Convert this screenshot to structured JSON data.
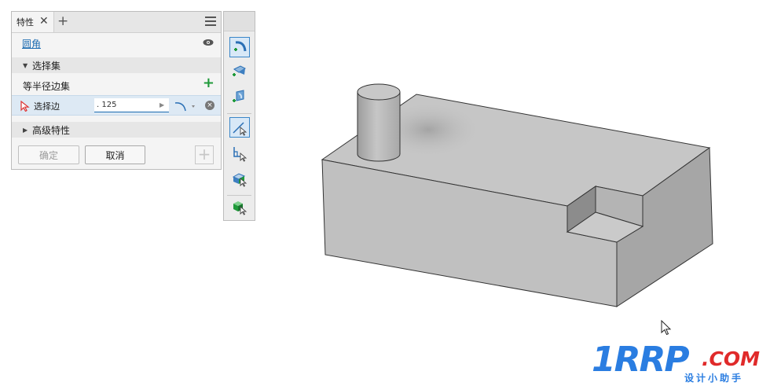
{
  "panel": {
    "tab_label": "特性",
    "tab_close": "✕",
    "tab_add": "+",
    "feature_name": "圆角",
    "section_selection": "选择集",
    "set_label": "等半径边集",
    "edge_label": "选择边",
    "radius_value": ". 125",
    "section_advanced": "高级特性",
    "ok_label": "确定",
    "cancel_label": "取消",
    "apply_label": "+"
  },
  "mini_toolbar": {
    "tools": [
      "fillet-edge-tool-icon",
      "face-fillet-tool-icon",
      "full-round-fillet-tool-icon",
      "select-edge-tool-icon",
      "select-loop-tool-icon",
      "select-feature-tool-icon",
      "select-solid-tool-icon"
    ]
  },
  "watermark": {
    "brand": "1RRP",
    "domain": ".COM",
    "subtitle": "设计小助手"
  },
  "colors": {
    "accent": "#1a6ab0",
    "add_green": "#1f9a3a",
    "selection_row": "#dde9f4",
    "watermark_blue": "#2a7de1",
    "watermark_red": "#e02a2a"
  }
}
